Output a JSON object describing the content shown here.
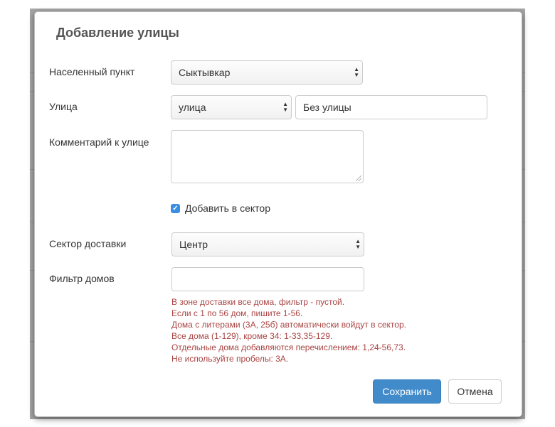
{
  "modal": {
    "title": "Добавление улицы",
    "fields": {
      "city": {
        "label": "Населенный пункт",
        "value": "Сыктывкар"
      },
      "street": {
        "label": "Улица",
        "type_value": "улица",
        "name_value": "Без улицы"
      },
      "comment": {
        "label": "Комментарий к улице",
        "value": ""
      },
      "add_to_sector": {
        "label": "Добавить в сектор",
        "checked": true
      },
      "delivery_sector": {
        "label": "Сектор доставки",
        "value": "Центр"
      },
      "house_filter": {
        "label": "Фильтр домов",
        "value": ""
      }
    },
    "help_lines": [
      "В зоне доставки все дома, фильтр - пустой.",
      "Если с 1 по 56 дом, пишите 1-56.",
      "Дома с литерами (3А, 25б) автоматически войдут в сектор.",
      "Все дома (1-129), кроме 34: 1-33,35-129.",
      "Отдельные дома добавляются перечислением: 1,24-56,73.",
      "Не используйте пробелы: 3А."
    ],
    "buttons": {
      "save": "Сохранить",
      "cancel": "Отмена"
    },
    "colors": {
      "primary": "#428bca",
      "help_text": "#a94442",
      "checkbox": "#3a8fe0"
    }
  }
}
